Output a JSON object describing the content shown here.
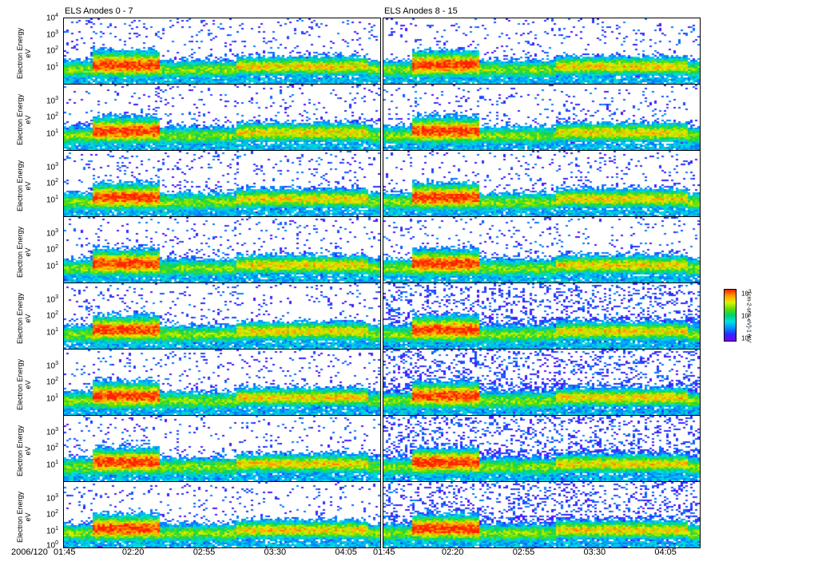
{
  "chart_data": {
    "type": "heatmap",
    "titles": [
      "ELS Anodes 0 - 7",
      "ELS Anodes 8 - 15"
    ],
    "ylabel": "Electron Energy",
    "yunit": "eV",
    "yscale": "log",
    "ylim": [
      1,
      10000
    ],
    "ytick_exponents_top": [
      "4",
      "3",
      "2",
      "1"
    ],
    "ytick_exponents": [
      "3",
      "2",
      "1"
    ],
    "ytick_exponent_bottom": "0",
    "date_label": "2006/120",
    "xticks": [
      "01:45",
      "02:20",
      "02:55",
      "03:30",
      "04:05"
    ],
    "xlim_minutes": [
      105,
      261
    ],
    "rows": 8,
    "colorbar": {
      "ticks": [
        "1",
        "2",
        "3"
      ],
      "unit": "(cm-2-sr-s-eV)-1 /eV",
      "colors": [
        "#7a00ff",
        "#2a2aff",
        "#0090ff",
        "#00e0e0",
        "#00d070",
        "#60e000",
        "#e0f000",
        "#ffa000",
        "#ff2000"
      ]
    },
    "features": {
      "plasma_sheet_start_min": 118,
      "plasma_sheet_end_min": 152,
      "peak_log_energy": 1.2
    }
  }
}
